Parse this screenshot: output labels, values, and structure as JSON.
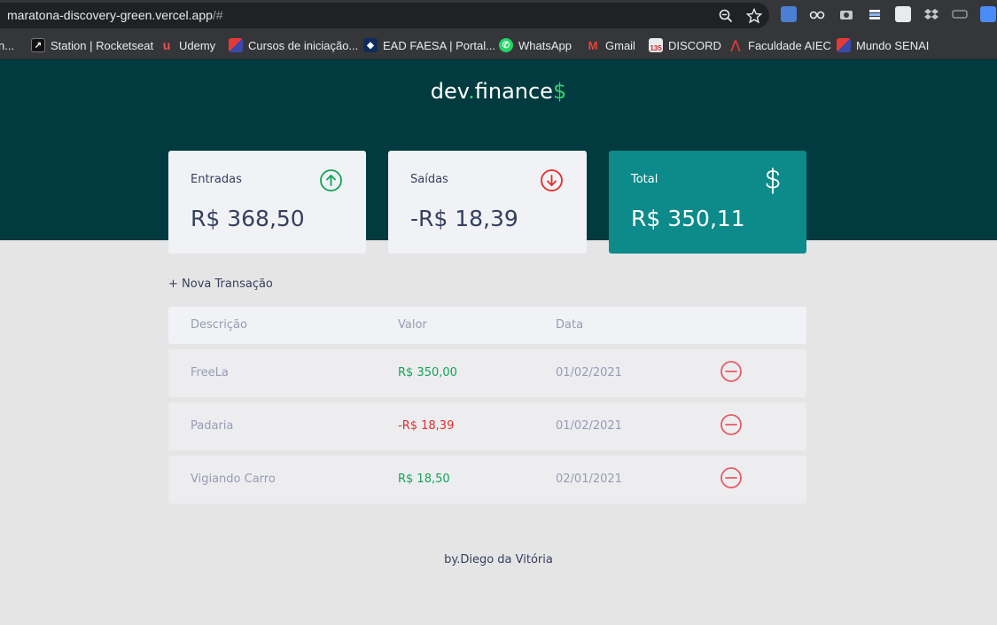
{
  "browser": {
    "url_main": "maratona-discovery-green.vercel.app",
    "url_tail": "/#",
    "bookmarks": [
      {
        "label": "n...",
        "icon": "bookmark-icon"
      },
      {
        "label": "Station | Rocketseat",
        "icon": "rocketseat-icon"
      },
      {
        "label": "Udemy",
        "icon": "udemy-icon"
      },
      {
        "label": "Cursos de iniciação...",
        "icon": "cursos-icon"
      },
      {
        "label": "EAD FAESA | Portal...",
        "icon": "faesa-icon"
      },
      {
        "label": "WhatsApp",
        "icon": "whatsapp-icon"
      },
      {
        "label": "Gmail",
        "icon": "gmail-icon"
      },
      {
        "label": "DISCORD",
        "icon": "calendar-icon",
        "badge": "135"
      },
      {
        "label": "Faculdade AIEC",
        "icon": "aiec-icon"
      },
      {
        "label": "Mundo SENAI",
        "icon": "senai-icon"
      }
    ]
  },
  "app": {
    "logo_a": "dev",
    "logo_dot": ".",
    "logo_b": "finance",
    "logo_dollar": "$"
  },
  "cards": {
    "income": {
      "label": "Entradas",
      "value": "R$ 368,50"
    },
    "expense": {
      "label": "Saídas",
      "value": "-R$ 18,39"
    },
    "total": {
      "label": "Total",
      "value": "R$ 350,11"
    }
  },
  "new_transaction": "+ Nova Transação",
  "table": {
    "headers": [
      "Descrição",
      "Valor",
      "Data"
    ],
    "rows": [
      {
        "description": "FreeLa",
        "amount": "R$ 350,00",
        "date": "01/02/2021",
        "type": "income"
      },
      {
        "description": "Padaria",
        "amount": "-R$ 18,39",
        "date": "01/02/2021",
        "type": "expense"
      },
      {
        "description": "Vigiando Carro",
        "amount": "R$ 18,50",
        "date": "02/01/2021",
        "type": "income"
      }
    ]
  },
  "footer": "by.Diego da Vitória",
  "colors": {
    "header_bg": "#013b40",
    "accent_green": "#2fd16f",
    "income": "#12a454",
    "expense": "#e92929",
    "total_card": "#0d8a8a"
  }
}
